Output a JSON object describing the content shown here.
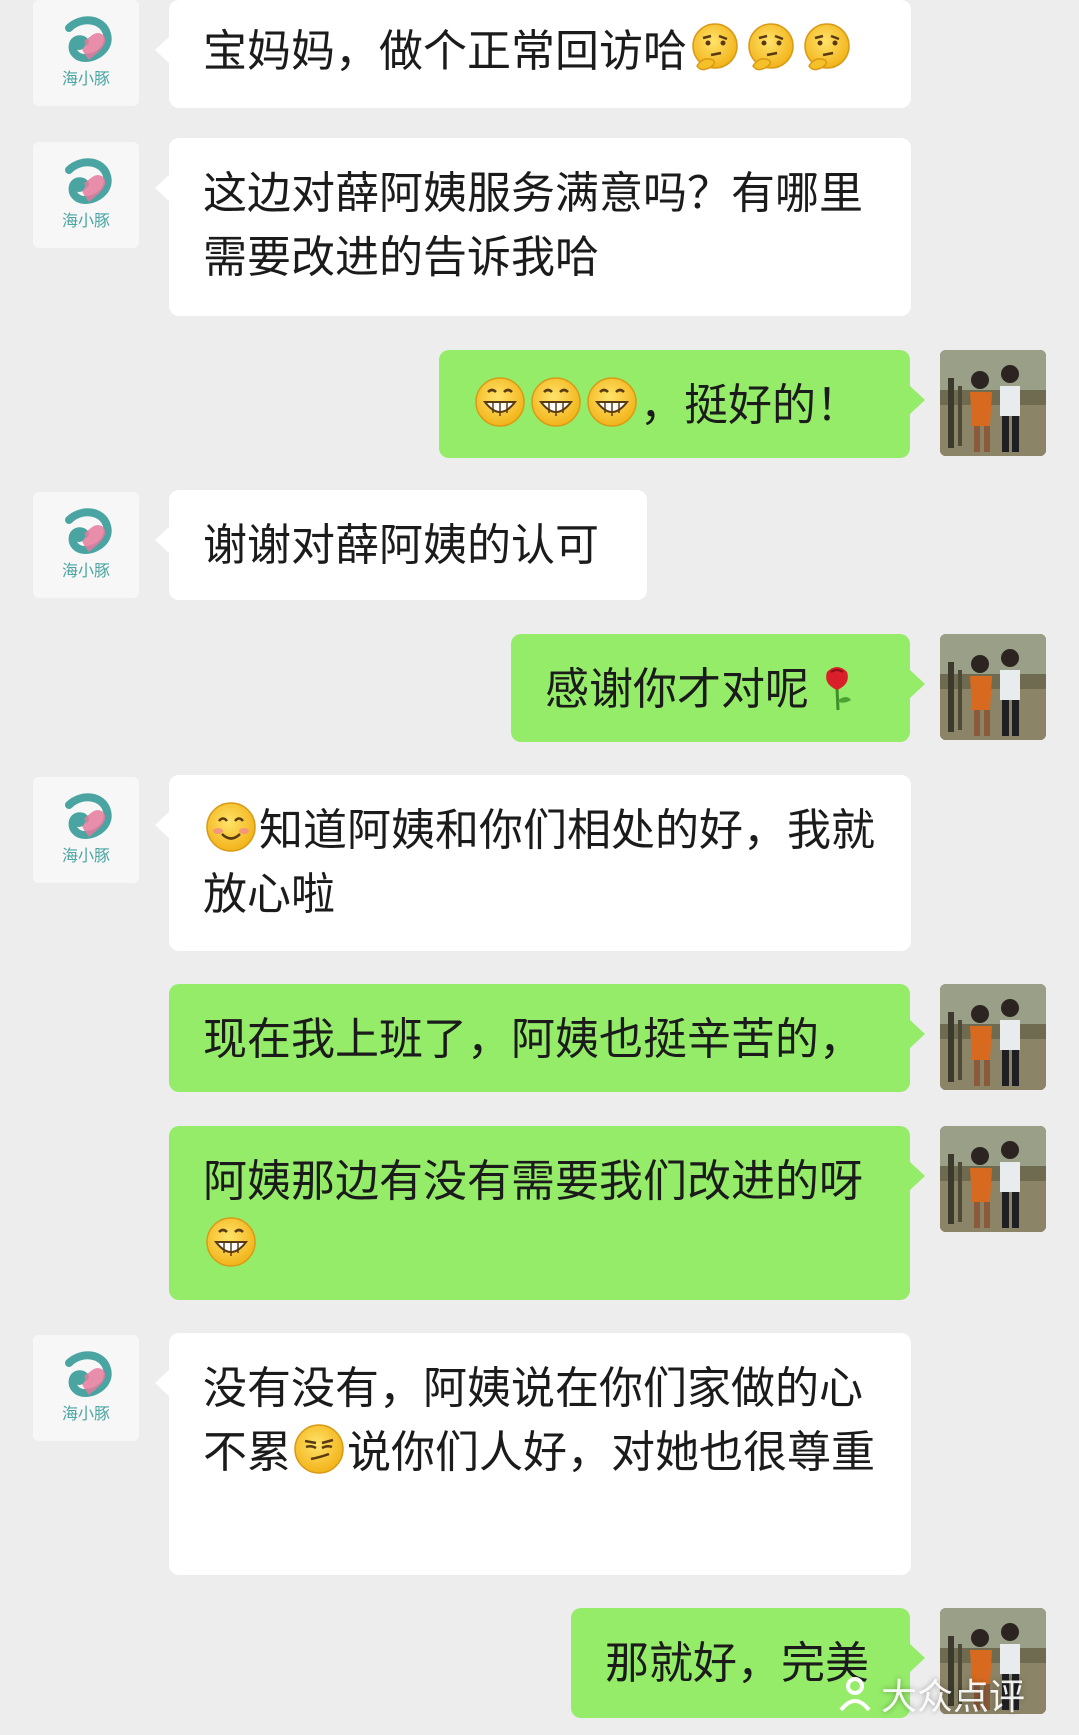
{
  "brand": {
    "logo_text": "海小豚",
    "accent": "#4aa5a2",
    "heart": "#e57a9c"
  },
  "bubble_colors": {
    "incoming": "#ffffff",
    "outgoing": "#95ec69",
    "background": "#ededed"
  },
  "messages": [
    {
      "side": "in",
      "before": "",
      "text": "宝妈妈，做个正常回访哈",
      "after_emoji": "thinking-emoji x3"
    },
    {
      "side": "in",
      "text": "这边对薛阿姨服务满意吗？有哪里需要改进的告诉我哈"
    },
    {
      "side": "out",
      "emoji_prefix": "grin-emoji x3",
      "text": "，挺好的！"
    },
    {
      "side": "in",
      "text": "谢谢对薛阿姨的认可"
    },
    {
      "side": "out",
      "text": "感谢你才对呢",
      "after_emoji": "rose-emoji"
    },
    {
      "side": "in",
      "emoji_prefix": "smile-emoji",
      "text": "知道阿姨和你们相处的好，我就放心啦"
    },
    {
      "side": "out",
      "text": "现在我上班了，阿姨也挺辛苦的，"
    },
    {
      "side": "out",
      "text": "阿姨那边有没有需要我们改进的呀",
      "after_emoji": "grin-emoji"
    },
    {
      "side": "in",
      "text_a": "没有没有，阿姨说在你们家做的心不累",
      "emoji_mid": "smirk-emoji",
      "text_b": "说你们人好，对她也很尊重"
    },
    {
      "side": "out",
      "text": "那就好，完美"
    }
  ],
  "watermark": {
    "text": "大众点评"
  }
}
